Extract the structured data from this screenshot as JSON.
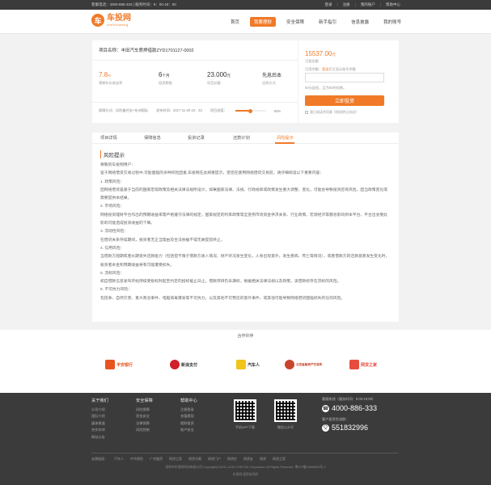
{
  "topbar": {
    "left": "客服电话：4000-886-333 | 服务时间：9：00-18：00",
    "links": [
      "登录",
      "注册",
      "我的账户",
      "帮助中心"
    ]
  },
  "logo": {
    "name": "车投网",
    "sub": "chetouwang"
  },
  "nav": [
    {
      "label": "首页",
      "active": false
    },
    {
      "label": "我要理财",
      "active": true
    },
    {
      "label": "安全保障",
      "active": false
    },
    {
      "label": "新手指引",
      "active": false
    },
    {
      "label": "信息披露",
      "active": false
    },
    {
      "label": "我的账号",
      "active": false
    }
  ],
  "project": {
    "name": "项目名称：丰田汽车质押借款ZYD1701127-0002",
    "stats": [
      {
        "value": "7.8",
        "unit": "%",
        "label": "预期年化收益率",
        "orange": true
      },
      {
        "value": "6",
        "unit": "个月",
        "label": "投资期限",
        "orange": false
      },
      {
        "value": "23.000",
        "unit": "元",
        "label": "项目总额",
        "orange": false
      },
      {
        "value": "先息后本",
        "unit": "",
        "label": "还款方式",
        "orange": false
      }
    ],
    "guarantee": "保障方式：风险备付金+东洲国际",
    "publish": "发布时间：2017-11-30 10：33",
    "progress_label": "项目进度：",
    "progress": 50,
    "progress_text": "50%"
  },
  "invest": {
    "amount": "15537.00",
    "amount_unit": "元",
    "amount_label": "可投金额",
    "balance_label": "可用余额：",
    "balance_link": "登录",
    "balance_tail": "后可显示账号余额",
    "input_placeholder": "",
    "hint": "50元起投，且为50的倍数。",
    "button": "立即投资",
    "agree": "我已阅读并同意《债权转让协议》"
  },
  "tabs": [
    {
      "label": "项目详情",
      "active": false
    },
    {
      "label": "保障信息",
      "active": false
    },
    {
      "label": "投资记录",
      "active": false
    },
    {
      "label": "还款计划",
      "active": false
    },
    {
      "label": "风险提示",
      "active": true
    }
  ],
  "content": {
    "title": "风险提示",
    "paragraphs": [
      "尊敬的车投网用户：",
      "鉴于网络借贷交易过程中,可能面临的多种风险因素,车投网在此郑重提示，望您在使用网络借贷交易前，请仔细阅读以下重要内容：",
      "1. 政策风险：",
      "因网络借贷是基于当前的国家宏观政策及相关法律法规所设计。如果国家法律、法规、行政规章或政策发生重大调整、变化，可能会导致投资您有风险，因当政策变化或需要提供本结果。",
      "2. 市场风险：",
      "网络投资理财平台作出的预期收益率需严格遵守法律的规定，国家规定的利率政策等全变例市场资金供求关系、行业政策、宏观经济等都会影响到本平台，平台出会受此影响可能造成投资收益的下降。",
      "3. 流动性风险：",
      "在借贷关系存续期间，投资者无正当理由及合法依据不得无故提前终止。",
      "4. 信用风险：",
      "当借款方短期或者长期丧失还款能力（包括但不限于借款方收入情况、财产状况发生变化，人身出现意外，发生疾病、死亡等情况），或者借款方的还款意愿发生变化时，投资者本金和预期收益将有可能遭受损失。",
      "5. 流标风险：",
      "如自借款信息发布开始持续受投标封起至约定的投标截止日止，借款项目仍未满标，根据相关法律法规以及政策，该借款标存在流标的风险。",
      "6. 不可抗力风险：",
      "包括争、自然灾害、重大政治事件、电脑病毒爆发等不可抗力，以及其他不可预见的意外事件，或其他可能导致网络借贷面临损失的任何风险。"
    ]
  },
  "partners": {
    "title": "合作伙伴",
    "items": [
      {
        "name": "平安银行",
        "color": "#e8541f"
      },
      {
        "name": "新浪支付",
        "color": "#d01f28"
      },
      {
        "name": "汽车人",
        "color": "#f0c419"
      },
      {
        "name": "北京金融资产交易所",
        "color": "#c8452d"
      },
      {
        "name": "网贷之家",
        "color": "#e84c3d"
      }
    ]
  },
  "footer": {
    "cols": [
      {
        "title": "关于我们",
        "items": [
          "公司介绍",
          "团队介绍",
          "媒体报道",
          "合作伙伴",
          "网站公告"
        ]
      },
      {
        "title": "安全保障",
        "items": [
          "风险保障",
          "资金安全",
          "法律保障",
          "风险控制"
        ]
      },
      {
        "title": "帮助中心",
        "items": [
          "注册登录",
          "充值提现",
          "理财投资",
          "账户安全"
        ]
      }
    ],
    "qr": [
      {
        "label": "手机APP下载"
      },
      {
        "label": "微信公众号"
      }
    ],
    "hotline_label": "客服热线（服务时间：9:00-18:00）",
    "hotline": "4000-886-333",
    "qq_label": "客户投资交流群：",
    "qq": "551832996",
    "friend_links_label": "友情链接：",
    "friend_links": [
      "汽车人",
      "中华保险",
      "广东融资",
      "网贷之家",
      "网贷天眼",
      "网贷门户",
      "网贷在",
      "网贷友",
      "网贷",
      "网贷之家"
    ],
    "copyright": [
      "深圳市车投网科技有限公司  Copyright(C)2011-2016 CHETOU Corporation All Rights Reserved.  粤ICP备15050853号-2",
      "车投网 投资有风险"
    ]
  },
  "colors": {
    "accent": "#f07a28",
    "dark": "#3b3b3b"
  }
}
